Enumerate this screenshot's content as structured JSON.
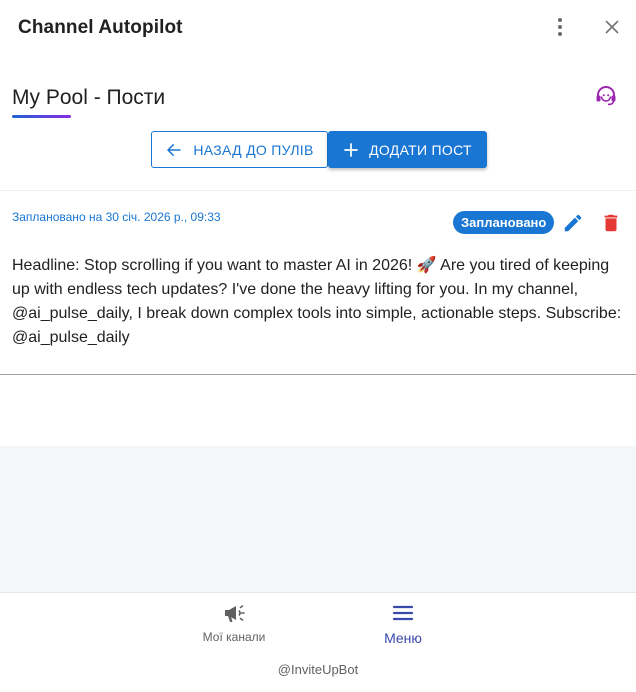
{
  "window": {
    "title": "Channel Autopilot",
    "menu_icon": "more-vertical-icon",
    "close_icon": "close-icon"
  },
  "header": {
    "title": "My Pool - Пости",
    "support_icon": "support-agent-icon"
  },
  "actions": {
    "back_label": "НАЗАД ДО ПУЛІВ",
    "add_label": "ДОДАТИ ПОСТ"
  },
  "post": {
    "scheduled_text": "Заплановано на 30 січ. 2026 р., 09:33",
    "status": "Заплановано",
    "body": "Headline: Stop scrolling if you want to master AI in 2026! 🚀 Are you tired of keeping up with endless tech updates? I've done the heavy lifting for you. In my channel, @ai_pulse_daily, I break down complex tools into simple, actionable steps. Subscribe: @ai_pulse_daily"
  },
  "bottom_nav": {
    "items": [
      {
        "label": "Мої канали",
        "icon": "megaphone-icon",
        "active": false
      },
      {
        "label": "Меню",
        "icon": "menu-icon",
        "active": true
      }
    ],
    "handle": "@InviteUpBot"
  },
  "colors": {
    "primary": "#1976d2",
    "support_icon": "#9c27b0",
    "delete": "#e53935",
    "active_nav": "#3949ab"
  }
}
